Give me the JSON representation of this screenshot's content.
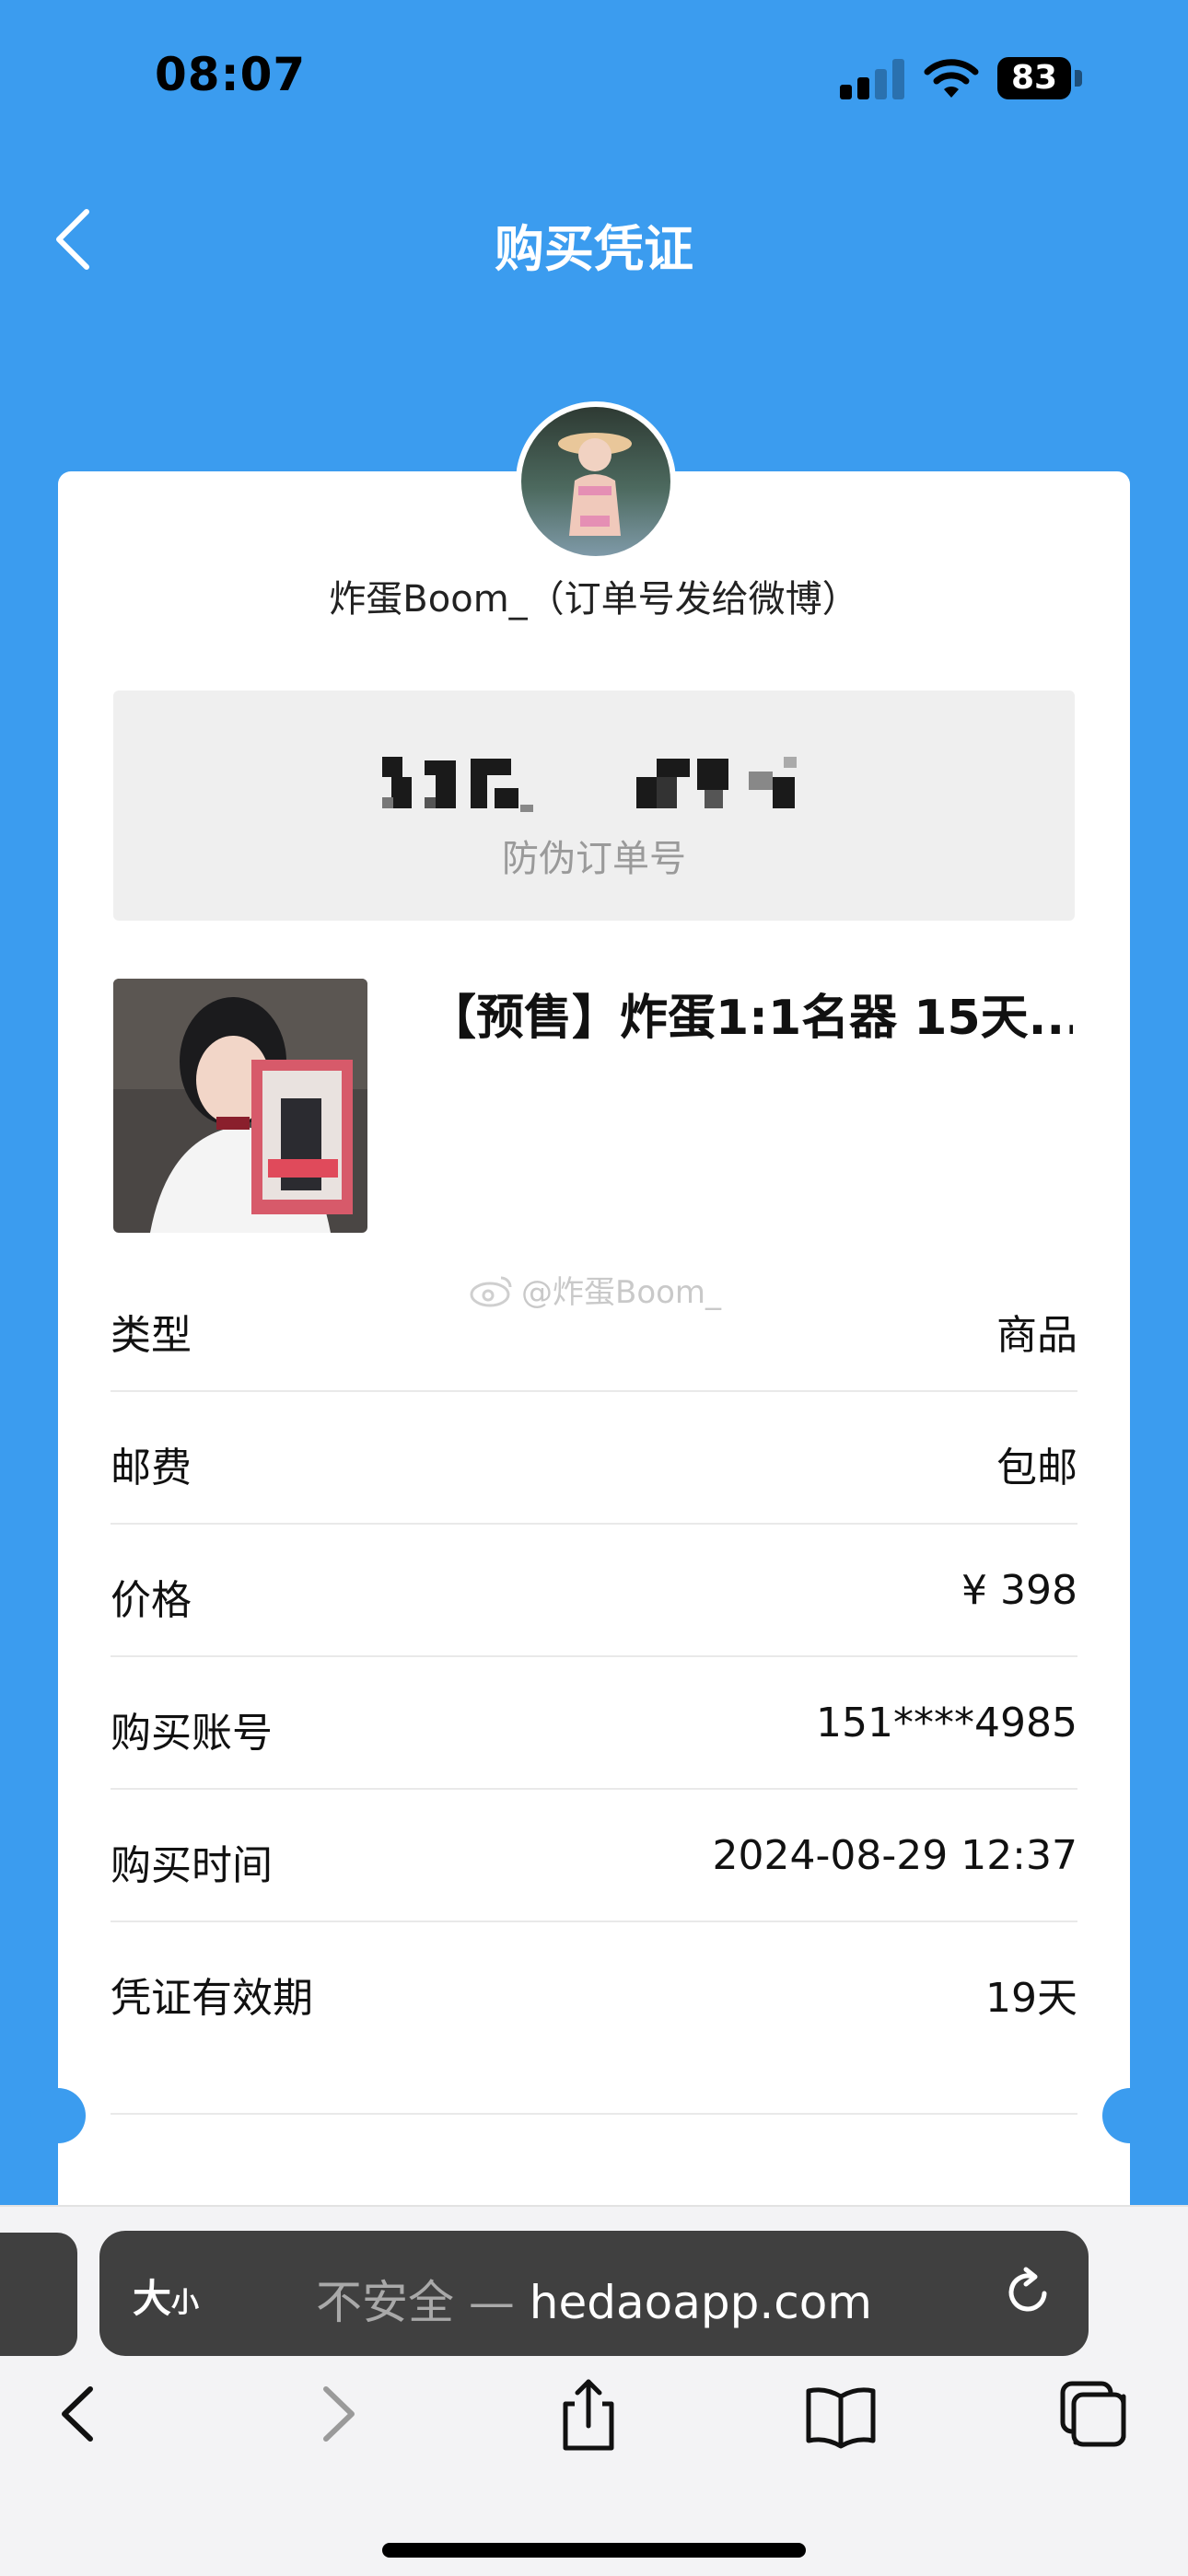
{
  "status_bar": {
    "time": "08:07",
    "battery": "83"
  },
  "nav": {
    "title": "购买凭证"
  },
  "seller": {
    "name": "炸蛋Boom_（订单号发给微博）"
  },
  "order": {
    "label": "防伪订单号"
  },
  "product": {
    "title": "【预售】炸蛋1:1名器 15天..."
  },
  "watermark": "@炸蛋Boom_",
  "details": [
    {
      "label": "类型",
      "value": "商品"
    },
    {
      "label": "邮费",
      "value": "包邮"
    },
    {
      "label": "价格",
      "value": "¥ 398"
    },
    {
      "label": "购买账号",
      "value": "151****4985"
    },
    {
      "label": "购买时间",
      "value": "2024-08-29 12:37"
    },
    {
      "label": "凭证有效期",
      "value": "19天"
    }
  ],
  "browser": {
    "text_size_big": "大",
    "text_size_small": "小",
    "insecure": "不安全 — ",
    "domain": "hedaoapp.com"
  },
  "colors": {
    "background": "#3b9cef",
    "card": "#ffffff",
    "order_box": "#efefef"
  },
  "icons": [
    "back-chevron-icon",
    "reload-icon",
    "browser-back-icon",
    "browser-forward-icon",
    "share-icon",
    "bookmarks-icon",
    "tabs-icon"
  ]
}
